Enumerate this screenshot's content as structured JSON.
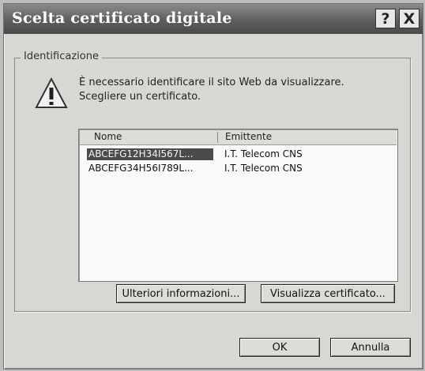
{
  "window": {
    "title": "Scelta certificato digitale",
    "help_glyph": "?",
    "close_glyph": "X"
  },
  "group": {
    "label": "Identificazione"
  },
  "message": {
    "line1": "È necessario identificare il sito Web da visualizzare.",
    "line2": "Scegliere un certificato."
  },
  "icon": {
    "name": "warning-icon"
  },
  "table": {
    "columns": [
      "Nome",
      "Emittente"
    ],
    "rows": [
      {
        "name": "ABCEFG12H34I567L...",
        "issuer": "I.T. Telecom CNS",
        "selected": true
      },
      {
        "name": "ABCEFG34H56I789L...",
        "issuer": "I.T. Telecom CNS",
        "selected": false
      }
    ]
  },
  "buttons": {
    "more_info": "Ulteriori informazioni...",
    "view_cert": "Visualizza certificato...",
    "ok": "OK",
    "cancel": "Annulla"
  }
}
